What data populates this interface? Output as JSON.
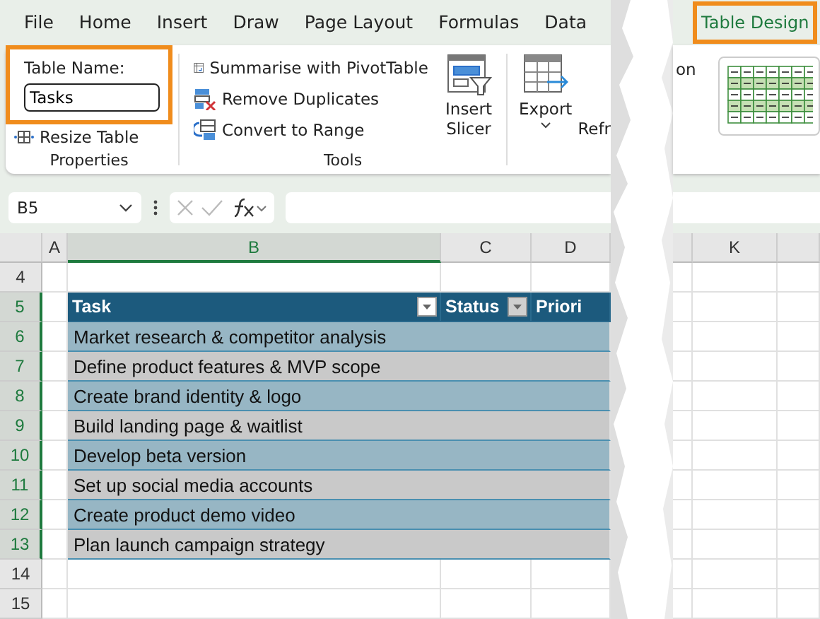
{
  "ribbon": {
    "tabs": [
      {
        "label": "File",
        "selected": false,
        "highlighted": false
      },
      {
        "label": "Home",
        "selected": false,
        "highlighted": false
      },
      {
        "label": "Insert",
        "selected": false,
        "highlighted": false
      },
      {
        "label": "Draw",
        "selected": false,
        "highlighted": false
      },
      {
        "label": "Page Layout",
        "selected": false,
        "highlighted": false
      },
      {
        "label": "Formulas",
        "selected": false,
        "highlighted": false
      },
      {
        "label": "Data",
        "selected": false,
        "highlighted": false
      }
    ],
    "tabs_after_tear": [
      {
        "label": "Table Design",
        "selected": true,
        "highlighted": true
      }
    ],
    "properties": {
      "table_name_label": "Table Name:",
      "table_name": "Tasks",
      "highlighted": true,
      "resize": "Resize Table",
      "group_label": "Properties"
    },
    "tools": {
      "commands": [
        "Summarise with PivotTable",
        "Remove Duplicates",
        "Convert to Range"
      ],
      "slicer": "Insert Slicer",
      "group_label": "Tools"
    },
    "export": "Export",
    "refresh": "Refr",
    "text_after_tear": "on"
  },
  "formula_bar": {
    "name_box": "B5"
  },
  "sheet": {
    "columns": [
      {
        "label": "A",
        "selected": false
      },
      {
        "label": "B",
        "selected": true
      },
      {
        "label": "C",
        "selected": false
      },
      {
        "label": "D",
        "selected": false
      }
    ],
    "columns_after_tear": [
      {
        "label": "K",
        "selected": false
      }
    ],
    "row_headers": [
      {
        "label": "4",
        "selected": false
      },
      {
        "label": "5",
        "selected": true
      },
      {
        "label": "6",
        "selected": true
      },
      {
        "label": "7",
        "selected": true
      },
      {
        "label": "8",
        "selected": true
      },
      {
        "label": "9",
        "selected": true
      },
      {
        "label": "10",
        "selected": true
      },
      {
        "label": "11",
        "selected": true
      },
      {
        "label": "12",
        "selected": true
      },
      {
        "label": "13",
        "selected": true
      },
      {
        "label": "14",
        "selected": false
      },
      {
        "label": "15",
        "selected": false
      }
    ],
    "table": {
      "header": [
        {
          "label": "Task",
          "filter": true,
          "filter_active": false
        },
        {
          "label": "Status",
          "filter": true,
          "filter_active": true
        },
        {
          "label": "Priori",
          "filter": false
        }
      ],
      "rows": [
        "Market research & competitor analysis",
        "Define product features & MVP scope",
        "Create brand identity & logo",
        "Build landing page & waitlist",
        "Develop beta version",
        "Set up social media accounts",
        "Create product demo video",
        "Plan launch campaign strategy"
      ]
    }
  }
}
